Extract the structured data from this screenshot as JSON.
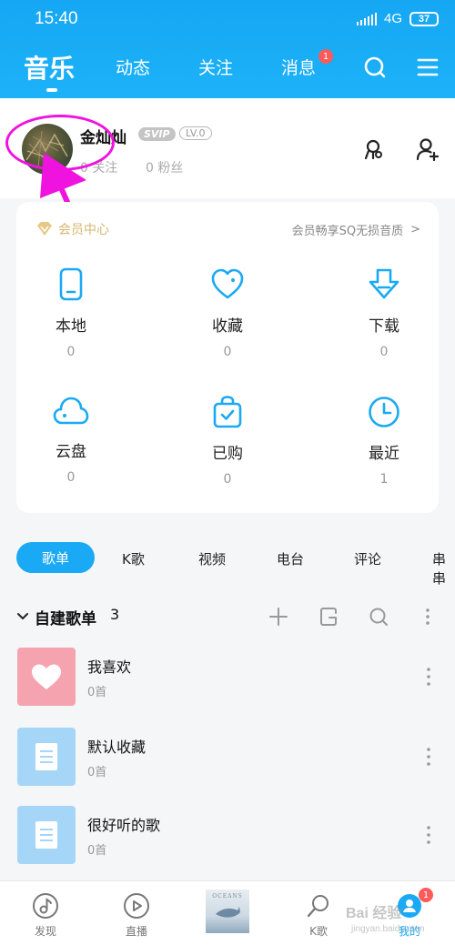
{
  "status_bar": {
    "time": "15:40",
    "network": "4G",
    "battery": "37"
  },
  "header": {
    "tabs": [
      {
        "label": "音乐"
      },
      {
        "label": "动态"
      },
      {
        "label": "关注"
      },
      {
        "label": "消息"
      }
    ],
    "messages_badge": "1",
    "search_icon": "search-icon",
    "menu_icon": "menu-icon"
  },
  "profile": {
    "username": "金灿灿",
    "svip_badge": "SVIP",
    "level": "LV.0",
    "following": "0 关注",
    "fans": "0 粉丝"
  },
  "vip_card": {
    "title": "会员中心",
    "promo": "会员畅享SQ无损音质",
    "chevron": ">"
  },
  "library": [
    {
      "label": "本地",
      "count": "0",
      "icon": "phone-icon"
    },
    {
      "label": "收藏",
      "count": "0",
      "icon": "heart-icon"
    },
    {
      "label": "下载",
      "count": "0",
      "icon": "download-icon"
    },
    {
      "label": "云盘",
      "count": "0",
      "icon": "cloud-icon"
    },
    {
      "label": "已购",
      "count": "0",
      "icon": "bag-icon"
    },
    {
      "label": "最近",
      "count": "1",
      "icon": "clock-icon"
    }
  ],
  "category_tabs": [
    "歌单",
    "K歌",
    "视频",
    "电台",
    "评论",
    "串串"
  ],
  "playlists_section": {
    "title": "自建歌单",
    "count": "3"
  },
  "playlists": [
    {
      "name": "我喜欢",
      "count": "0首"
    },
    {
      "name": "默认收藏",
      "count": "0首"
    },
    {
      "name": "很好听的歌",
      "count": "0首"
    }
  ],
  "bottom_nav": [
    {
      "label": "发现"
    },
    {
      "label": "直播"
    },
    {
      "label": ""
    },
    {
      "label": "K歌"
    },
    {
      "label": "我的"
    }
  ],
  "bottom_badge": "1",
  "album_text": "OCEANS",
  "watermark": "Bai 经验",
  "watermark_url": "jingyan.baidu.com",
  "colors": {
    "accent": "#1aa9f4",
    "annotation": "#f013e0",
    "vip_gold": "#d7b56e"
  }
}
